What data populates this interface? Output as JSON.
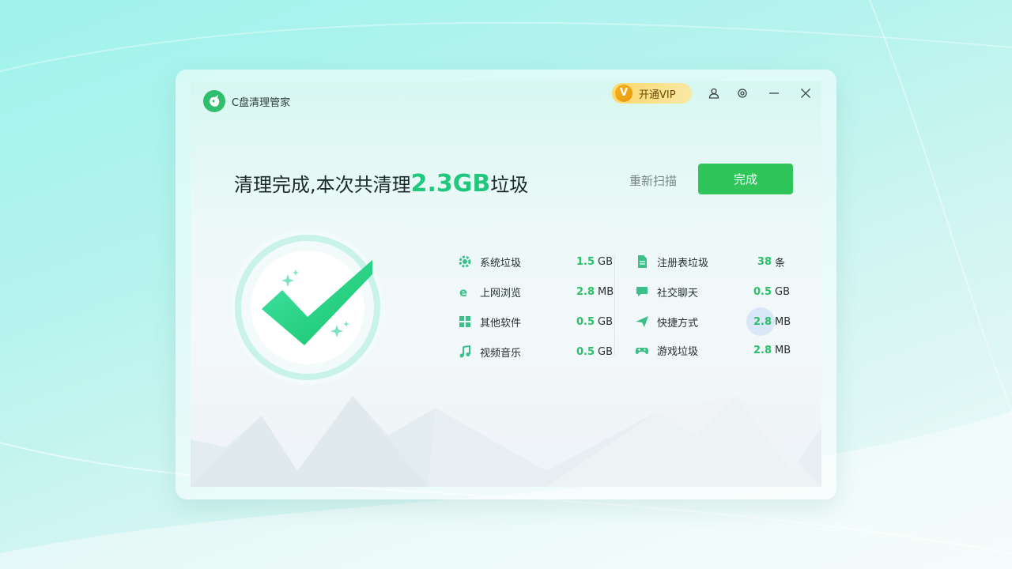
{
  "app": {
    "title": "C盘清理管家"
  },
  "toolbar": {
    "vip_badge": "V",
    "vip_label": "开通VIP",
    "icons": [
      "user-icon",
      "settings-icon",
      "minimize-icon",
      "close-icon"
    ]
  },
  "result": {
    "prefix": "清理完成,本次共清理",
    "amount": "2.3GB",
    "suffix": "垃圾"
  },
  "actions": {
    "rescan_label": "重新扫描",
    "done_label": "完成"
  },
  "stats_left": [
    {
      "icon": "gear-icon",
      "label": "系统垃圾",
      "value": "1.5",
      "unit": "GB"
    },
    {
      "icon": "browser-icon",
      "label": "上网浏览",
      "value": "2.8",
      "unit": "MB"
    },
    {
      "icon": "apps-icon",
      "label": "其他软件",
      "value": "0.5",
      "unit": "GB"
    },
    {
      "icon": "music-icon",
      "label": "视频音乐",
      "value": "0.5",
      "unit": "GB"
    }
  ],
  "stats_right": [
    {
      "icon": "document-icon",
      "label": "注册表垃圾",
      "value": "38",
      "unit": "条"
    },
    {
      "icon": "chat-icon",
      "label": "社交聊天",
      "value": "0.5",
      "unit": "GB"
    },
    {
      "icon": "send-icon",
      "label": "快捷方式",
      "value": "2.8",
      "unit": "MB"
    },
    {
      "icon": "gamepad-icon",
      "label": "游戏垃圾",
      "value": "2.8",
      "unit": "MB"
    }
  ],
  "colors": {
    "accent": "#22c77e",
    "button": "#2fc55b",
    "vip": "#ffd86a"
  }
}
